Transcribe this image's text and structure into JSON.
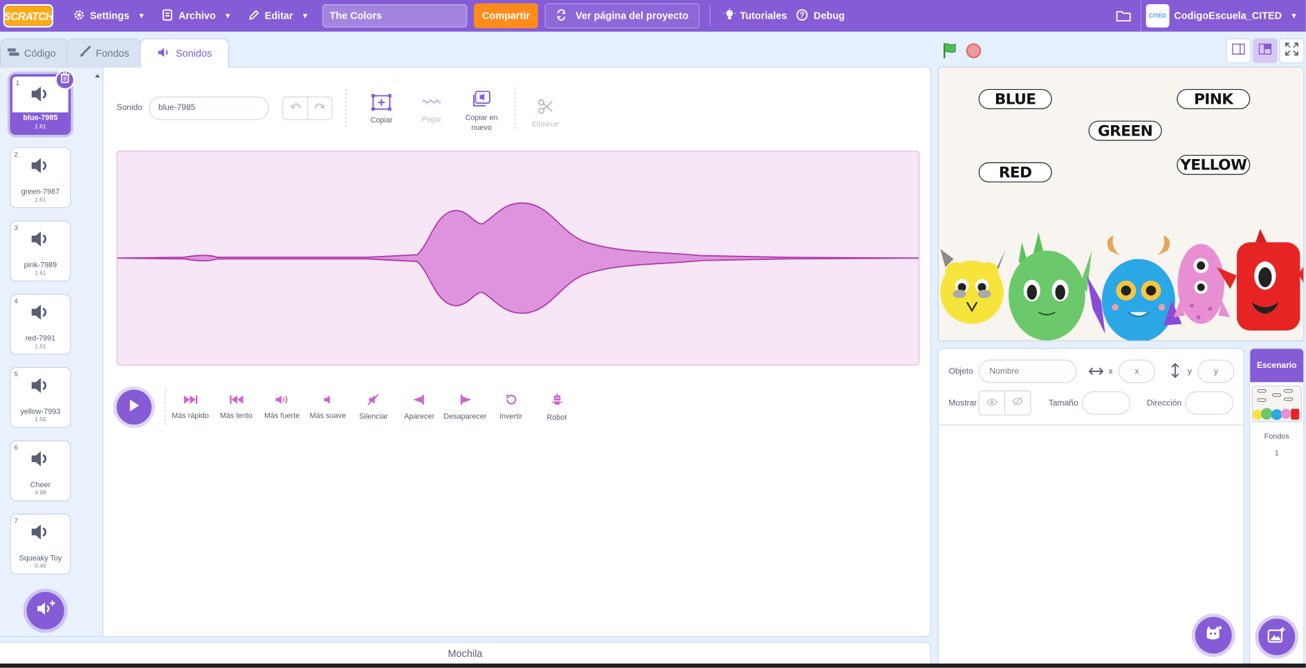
{
  "menubar": {
    "logo": "SCRATCH",
    "settings": "Settings",
    "file": "Archivo",
    "edit": "Editar",
    "project_title": "The Colors",
    "share": "Compartir",
    "see_project": "Ver página del proyecto",
    "tutorials": "Tutoriales",
    "debug": "Debug",
    "username": "CodigoEscuela_CITED",
    "avatar_text": "CITED"
  },
  "tabs": {
    "code": "Código",
    "backdrops": "Fondos",
    "sounds": "Sonidos"
  },
  "sounds": [
    {
      "num": "1",
      "name": "blue-7985",
      "duration": "1.61"
    },
    {
      "num": "2",
      "name": "green-7987",
      "duration": "1.61"
    },
    {
      "num": "3",
      "name": "pink-7989",
      "duration": "1.61"
    },
    {
      "num": "4",
      "name": "red-7991",
      "duration": "1.61"
    },
    {
      "num": "5",
      "name": "yellow-7993",
      "duration": "1.56"
    },
    {
      "num": "6",
      "name": "Cheer",
      "duration": "4.98"
    },
    {
      "num": "7",
      "name": "Squeaky Toy",
      "duration": "0.46"
    }
  ],
  "editor": {
    "sound_label": "Sonido",
    "sound_name": "blue-7985",
    "copy": "Copiar",
    "paste": "Pegar",
    "copy_new_1": "Copiar en",
    "copy_new_2": "nuevo",
    "delete": "Eliminar"
  },
  "effects": [
    "Más rápido",
    "Más lento",
    "Más fuerte",
    "Más suave",
    "Silenciar",
    "Aparecer",
    "Desaparecer",
    "Invertir",
    "Robot"
  ],
  "backpack": "Mochila",
  "stage": {
    "words": {
      "blue": "BLUE",
      "pink": "PINK",
      "green": "GREEN",
      "red": "RED",
      "yellow": "YELLOW"
    }
  },
  "sprite_info": {
    "object_label": "Objeto",
    "name_placeholder": "Nombre",
    "x_label": "x",
    "x_placeholder": "x",
    "y_label": "y",
    "y_placeholder": "y",
    "show_label": "Mostrar",
    "size_label": "Tamaño",
    "direction_label": "Dirección"
  },
  "stage_panel": {
    "title": "Escenario",
    "backdrops_label": "Fondos",
    "backdrops_count": "1"
  },
  "colors": {
    "accent": "#855cd6",
    "orange": "#ff8c1a",
    "wave_fill": "#dd94dd",
    "wave_stroke": "#b03aad"
  }
}
